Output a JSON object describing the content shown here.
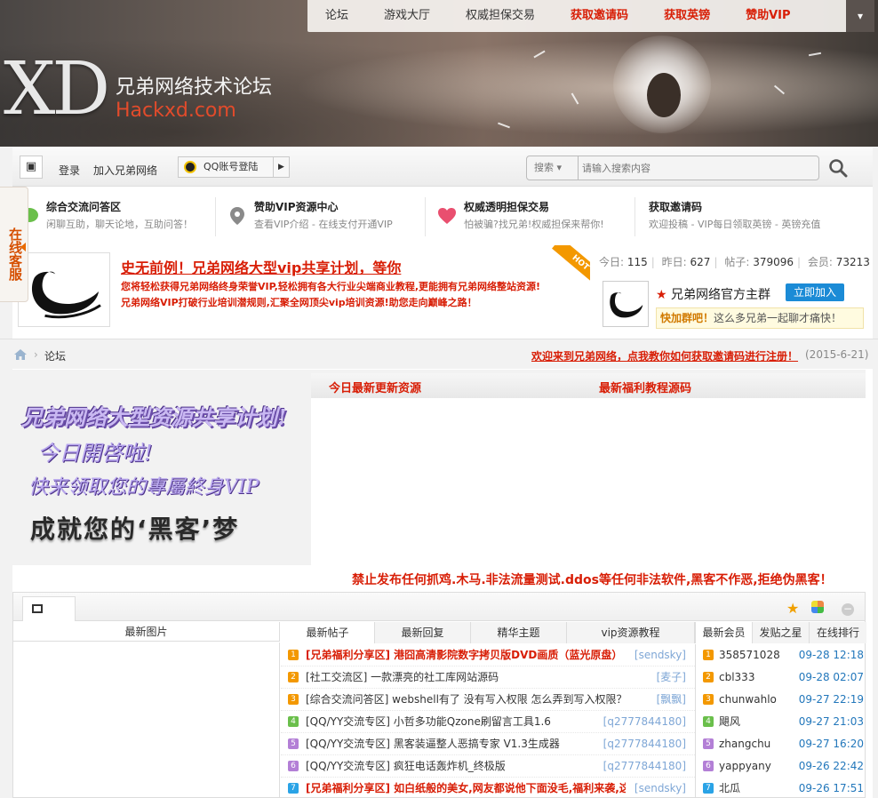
{
  "topnav": {
    "items": [
      "论坛",
      "游戏大厅",
      "权威担保交易",
      "获取邀请码",
      "获取英镑",
      "赞助VIP"
    ],
    "dropdown_icon": "chevron-down-icon"
  },
  "logo": {
    "mark": "XD",
    "title": "兄弟网络技术论坛",
    "domain": "Hackxd.com"
  },
  "toolbar": {
    "login": "登录",
    "join": "加入兄弟网络",
    "qq_login": "QQ账号登陆",
    "search_select": "搜索",
    "search_placeholder": "请输入搜索内容"
  },
  "promos": [
    {
      "title": "综合交流问答区",
      "desc": "闲聊互助，聊天论地，互助问答！",
      "icon": "chat-bubble-icon",
      "color": "#6abf4b"
    },
    {
      "title": "赞助VIP资源中心",
      "desc": "查看VIP介绍 - 在线支付开通VIP",
      "icon": "location-pin-icon",
      "color": "#8a8a8a"
    },
    {
      "title": "权威透明担保交易",
      "desc": "怕被骗?找兄弟!权威担保来帮你!",
      "icon": "heart-icon",
      "color": "#e94f6f"
    },
    {
      "title": "获取邀请码",
      "desc": "欢迎投稿 - VIP每日领取英镑 - 英镑充值",
      "icon": "",
      "color": ""
    }
  ],
  "headline": {
    "title": "史无前例！兄弟网络大型vip共享计划，等你",
    "line1": "您将轻松获得兄弟网络终身荣誉VIP,轻松拥有各大行业尖端商业教程,更能拥有兄弟网络整站资源!",
    "line2": "兄弟网络VIP打破行业培训潜规则,汇聚全网顶尖vip培训资源!助您走向巅峰之路！",
    "badge": "HOT"
  },
  "stats": {
    "today_label": "今日:",
    "today": "115",
    "yesterday_label": "昨日:",
    "yesterday": "627",
    "posts_label": "帖子:",
    "posts": "379096",
    "members_label": "会员:",
    "members": "73213"
  },
  "group": {
    "name": "兄弟网络官方主群",
    "join": "立即加入",
    "tip_bold": "快加群吧！",
    "tip": "这么多兄弟一起聊才痛快！"
  },
  "side_tab": "在线客服",
  "breadcrumb": {
    "current": "论坛",
    "notice": "欢迎来到兄弟网络，点我教你如何获取邀请码进行注册！",
    "date": "(2015-6-21)"
  },
  "mid_tabs": [
    "今日最新更新资源",
    "最新福利教程源码"
  ],
  "ad": {
    "line1": "兄弟网络大型资源共享计划!",
    "line2": "今日開啓啦!",
    "line3": "快来领取您的專屬終身VIP",
    "line4": "成就您的‘黑客’梦"
  },
  "warning": "禁止发布任何抓鸡.木马.非法流量测试.ddos等任何非法软件,黑客不作恶,拒绝伪黑客！",
  "list": {
    "pic_header": "最新图片",
    "post_tabs": [
      "最新帖子",
      "最新回复",
      "精华主题",
      "vip资源教程"
    ],
    "right_tabs": [
      "最新会员",
      "发贴之星",
      "在线排行"
    ],
    "posts": [
      {
        "n": "1",
        "title": "[兄弟福利分享区] 港囧高清影院数字拷贝版DVD画质（蓝光原盘）",
        "author": "[sendsky]",
        "red": true
      },
      {
        "n": "2",
        "title": "[社工交流区] 一款漂亮的社工库网站源码",
        "author": "[麦子]",
        "red": false
      },
      {
        "n": "3",
        "title": "[综合交流问答区] webshell有了 没有写入权限 怎么弄到写入权限？大牛",
        "author": "[飘飘]",
        "red": false
      },
      {
        "n": "4",
        "title": "[QQ/YY交流专区] 小哲多功能Qzone刷留言工具1.6",
        "author": "[q2777844180]",
        "red": false
      },
      {
        "n": "5",
        "title": "[QQ/YY交流专区] 黑客装逼整人恶搞专家 V1.3生成器",
        "author": "[q2777844180]",
        "red": false
      },
      {
        "n": "6",
        "title": "[QQ/YY交流专区] 疯狂电话轰炸机_终极版",
        "author": "[q2777844180]",
        "red": false
      },
      {
        "n": "7",
        "title": "[兄弟福利分享区] 如白纸般的美女,网友都说他下面没毛,福利来袭,这",
        "author": "[sendsky]",
        "red": true
      }
    ],
    "members": [
      {
        "n": "1",
        "name": "358571028",
        "time": "09-28 12:18"
      },
      {
        "n": "2",
        "name": "cbl333",
        "time": "09-28 02:07"
      },
      {
        "n": "3",
        "name": "chunwahlo",
        "time": "09-27 22:19"
      },
      {
        "n": "4",
        "name": "飓风",
        "time": "09-27 21:03"
      },
      {
        "n": "5",
        "name": "zhangchu",
        "time": "09-27 16:20"
      },
      {
        "n": "6",
        "name": "yappyany",
        "time": "09-26 22:42"
      },
      {
        "n": "7",
        "name": "北瓜",
        "time": "09-26 17:51"
      }
    ],
    "num_colors": [
      "#f39800",
      "#f39800",
      "#f39800",
      "#6abf4b",
      "#b37fd6",
      "#b37fd6",
      "#2aa3e6"
    ]
  },
  "colors": {
    "accent_red": "#d81e06",
    "link_blue": "#2277bb",
    "join_blue": "#1b8bd6",
    "orange": "#f39800"
  }
}
